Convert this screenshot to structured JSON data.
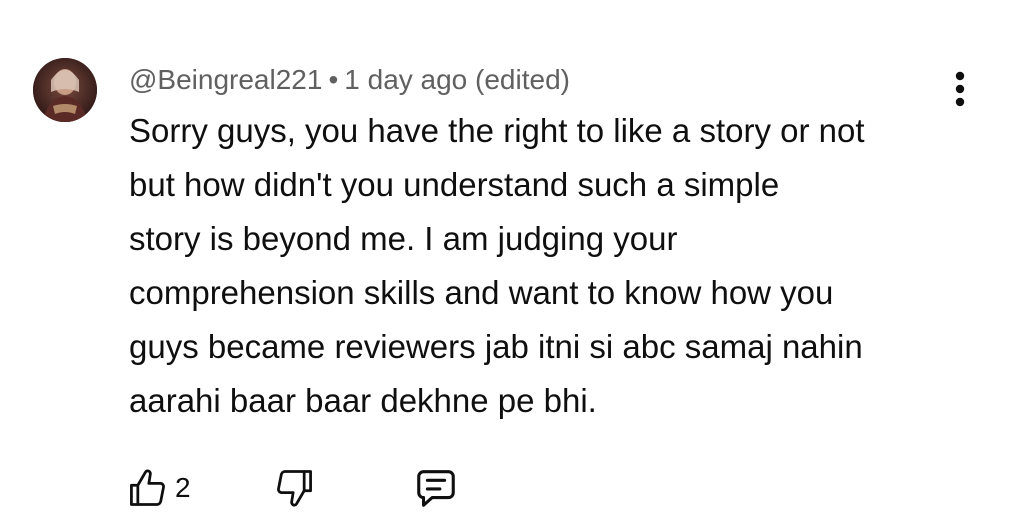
{
  "comment": {
    "author": "@Beingreal221",
    "separator": "•",
    "timestamp": "1 day ago (edited)",
    "text": "Sorry guys, you have the right to like a story or not\nbut how didn't you understand such a simple\nstory is beyond me. I am judging your\ncomprehension skills and want to know how you\nguys became reviewers jab itni si abc samaj nahin\naarahi baar baar dekhne pe bhi.",
    "like_count": "2"
  },
  "icons": {
    "menu": "more-vertical-icon",
    "like": "thumbs-up-icon",
    "dislike": "thumbs-down-icon",
    "reply": "comment-reply-icon"
  },
  "colors": {
    "text": "#0f0f0f",
    "meta": "#606060",
    "background": "#ffffff"
  }
}
